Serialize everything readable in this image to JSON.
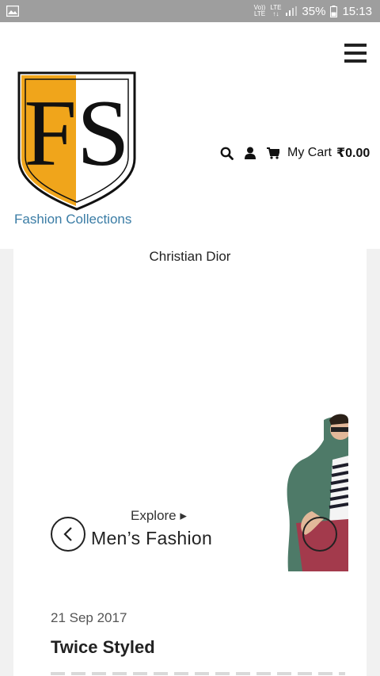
{
  "status_bar": {
    "network_top": "Vo))",
    "network_bottom": "LTE",
    "lte_label": "LTE",
    "battery": "35%",
    "time": "15:13"
  },
  "header": {
    "logo_text": "FS",
    "tagline": "Fashion Collections",
    "cart_label": "My Cart",
    "cart_total": "₹0.00"
  },
  "card": {
    "brand_name": "Christian Dior",
    "banner": {
      "explore": "Explore ▸",
      "title": "Men’s Fashion"
    },
    "post": {
      "date": "21 Sep 2017",
      "title": "Twice Styled"
    }
  },
  "colors": {
    "logo_orange": "#f0a51b",
    "tagline_blue": "#3a7ca5",
    "status_bar": "#9e9e9e"
  },
  "icons": [
    "image-icon",
    "signal-icon",
    "battery-icon",
    "menu-icon",
    "search-icon",
    "user-icon",
    "cart-icon",
    "chevron-left-icon",
    "chevron-right-icon"
  ]
}
